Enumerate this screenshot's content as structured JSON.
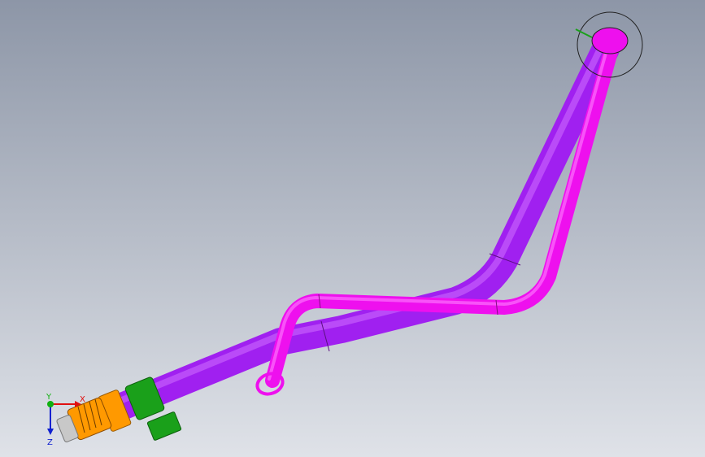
{
  "viewport": {
    "background_top": "#8d96a7",
    "background_bottom": "#dfe2e8"
  },
  "model": {
    "main_tube_color": "#a020f0",
    "main_tube_highlight": "#d070ff",
    "secondary_tube_color": "#ee10ee",
    "secondary_tube_highlight": "#ff80ff",
    "collar_color": "#1aa01a",
    "nut_color": "#ff9900",
    "fitting_color": "#c8c8c8"
  },
  "triad": {
    "x_label": "X",
    "y_label": "Y",
    "z_label": "Z",
    "x_color": "#e01010",
    "y_color": "#10b010",
    "z_color": "#1020d0"
  }
}
